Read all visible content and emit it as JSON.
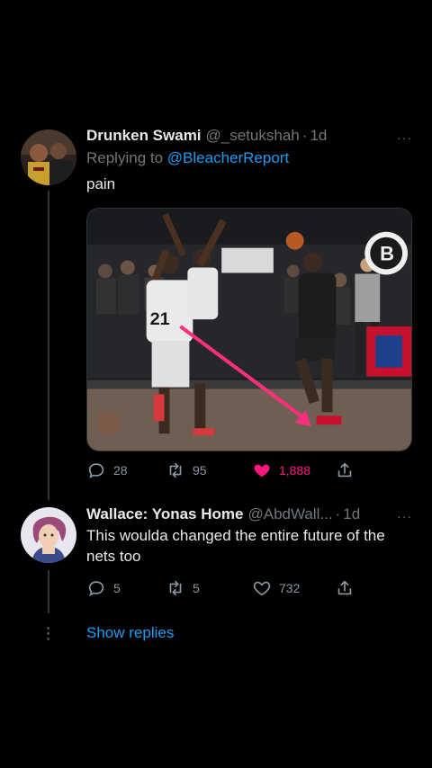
{
  "tweet1": {
    "name": "Drunken Swami",
    "handle": "@_setukshah",
    "separator": "·",
    "time": "1d",
    "more": "···",
    "replying_prefix": "Replying to",
    "replying_handle": "@BleacherReport",
    "text": "pain",
    "media_alt": "Basketball game clip",
    "jersey_number": "21",
    "stats": {
      "replies": "28",
      "retweets": "95",
      "likes": "1,888"
    }
  },
  "tweet2": {
    "name": "Wallace: Yonas Home",
    "handle": "@AbdWall...",
    "separator": "·",
    "time": "1d",
    "more": "···",
    "text": "This woulda changed the entire future of the nets too",
    "stats": {
      "replies": "5",
      "retweets": "5",
      "likes": "732"
    }
  },
  "show_replies": "Show replies",
  "icons": {
    "reply": "reply-icon",
    "retweet": "retweet-icon",
    "like": "heart-icon",
    "share": "share-icon"
  },
  "colors": {
    "background": "#000000",
    "link": "#1d9bf0",
    "like": "#f91880",
    "muted": "#71767b"
  }
}
